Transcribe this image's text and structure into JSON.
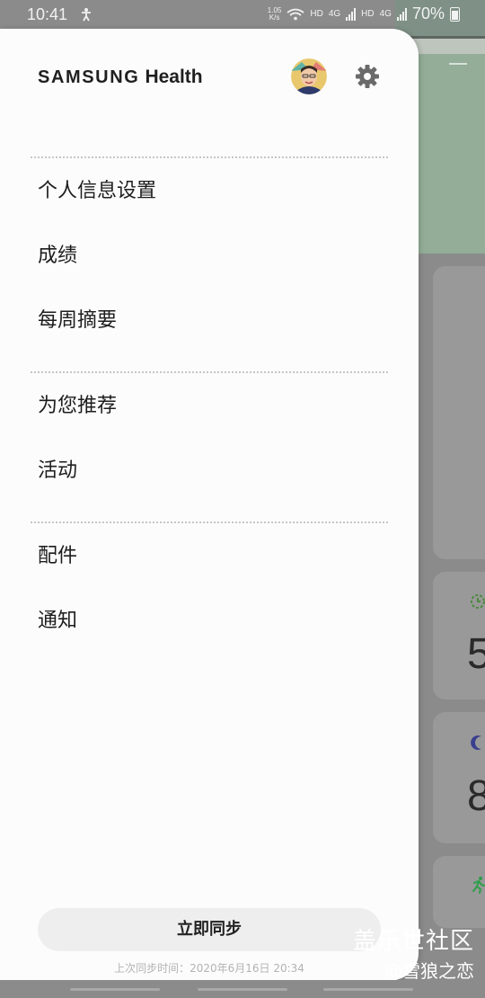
{
  "status_bar": {
    "time": "10:41",
    "net_speed_value": "1.05",
    "net_speed_unit": "K/s",
    "hd1": "HD",
    "lte1": "4G",
    "hd2": "HD",
    "lte2": "4G",
    "battery": "70%"
  },
  "drawer": {
    "brand_samsung": "SAMSUNG",
    "brand_health": "Health",
    "avatar": "avatar",
    "settings_icon": "gear-icon",
    "menu_groups": [
      {
        "items": [
          "个人信息设置",
          "成绩",
          "每周摘要"
        ]
      },
      {
        "items": [
          "为您推荐",
          "活动"
        ]
      },
      {
        "items": [
          "配件",
          "通知"
        ]
      }
    ],
    "sync_button": "立即同步",
    "last_sync": "上次同步时间：2020年6月16日 20:34"
  },
  "background": {
    "number_1": "5",
    "number_2": "8",
    "icons": [
      "timer-icon",
      "moon-icon",
      "running-icon"
    ]
  },
  "watermark": {
    "line1": "盖乐世社区",
    "line2": "@雪狼之恋"
  },
  "colors": {
    "drawer_bg": "#fcfcfc",
    "scrim": "#8b8b8b",
    "header_green": "#93ad98",
    "accent_green": "#2e9e4a",
    "moon_blue": "#3a3f8f"
  }
}
